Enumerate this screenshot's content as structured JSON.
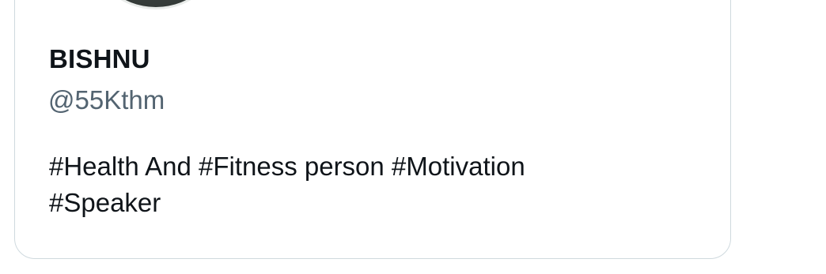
{
  "profile": {
    "display_name": "BISHNU",
    "handle": "@55Kthm",
    "bio_lines": [
      "#Health And #Fitness person #Motivation",
      "#Speaker"
    ]
  },
  "colors": {
    "text_primary": "#0f1419",
    "text_secondary": "#536471",
    "card_border": "#cfd9de"
  }
}
